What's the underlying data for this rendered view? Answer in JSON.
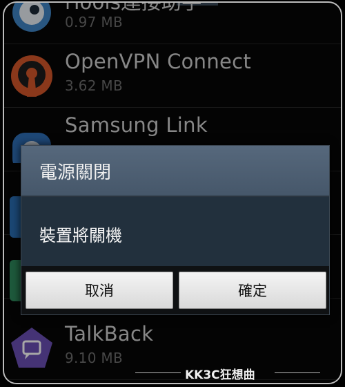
{
  "apps": [
    {
      "name": "iTools連接助手",
      "size": "0.97 MB",
      "icon": "itools-icon"
    },
    {
      "name": "OpenVPN Connect",
      "size": "3.62 MB",
      "icon": "openvpn-icon"
    },
    {
      "name": "Samsung Link",
      "size": "",
      "icon": "samsung-link-icon"
    },
    {
      "name": "",
      "size": "",
      "icon": "app-icon"
    },
    {
      "name": "",
      "size": "",
      "icon": "app-icon"
    },
    {
      "name": "TalkBack",
      "size": "9.10 MB",
      "icon": "talkback-icon"
    }
  ],
  "dialog": {
    "title": "電源關閉",
    "message": "裝置將關機",
    "cancel_label": "取消",
    "confirm_label": "確定"
  },
  "watermark": "KK3C狂想曲",
  "colors": {
    "dialog_title_bg": "#4e6073",
    "dialog_body_bg": "#22303d",
    "openvpn_orange": "#d4572a",
    "talkback_purple": "#6a4fb4",
    "itools_blue": "#3f85c5"
  }
}
